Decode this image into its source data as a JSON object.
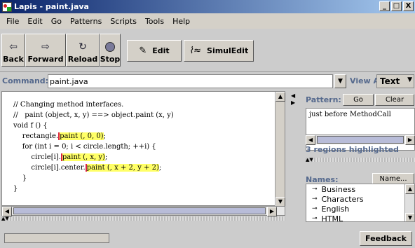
{
  "window": {
    "title": "Lapis - paint.java",
    "controls": [
      "_",
      "□",
      "X"
    ]
  },
  "menu": [
    "File",
    "Edit",
    "Go",
    "Patterns",
    "Scripts",
    "Tools",
    "Help"
  ],
  "toolbar": {
    "back": {
      "label": "Back",
      "icon": "back-arrow-icon"
    },
    "forward": {
      "label": "Forward",
      "icon": "forward-arrow-icon"
    },
    "reload": {
      "label": "Reload",
      "icon": "reload-icon"
    },
    "stop": {
      "label": "Stop",
      "icon": "stop-icon"
    },
    "edit": {
      "label": "Edit",
      "icon": "pencil-icon"
    },
    "simuledit": {
      "label": "SimulEdit",
      "icon": "simuledit-icon"
    }
  },
  "command": {
    "label": "Command:",
    "value": "paint.java",
    "view_as_label": "View As:",
    "view_as_value": "Text"
  },
  "editor": {
    "lines": [
      {
        "parts": [
          {
            "text": "// Changing method interfaces."
          }
        ]
      },
      {
        "parts": [
          {
            "text": "//   paint (object, x, y) ==> object.paint (x, y)"
          }
        ]
      },
      {
        "parts": [
          {
            "text": "void f () {"
          }
        ]
      },
      {
        "parts": [
          {
            "text": "    rectangle."
          },
          {
            "text": "paint (, 0, 0)",
            "hl": true
          },
          {
            "text": ";"
          }
        ]
      },
      {
        "parts": [
          {
            "text": "    for (int i = 0; i < circle.length; ++i) {"
          }
        ]
      },
      {
        "parts": [
          {
            "text": "        circle[i]."
          },
          {
            "text": "paint (, x, y)",
            "hl": true
          },
          {
            "text": ";"
          }
        ]
      },
      {
        "parts": [
          {
            "text": "        circle[i].center."
          },
          {
            "text": "paint (, x + 2, y + 2)",
            "hl": true
          },
          {
            "text": ";"
          }
        ]
      },
      {
        "parts": [
          {
            "text": "    }"
          }
        ]
      },
      {
        "parts": [
          {
            "text": "}"
          }
        ]
      }
    ]
  },
  "pattern_panel": {
    "label": "Pattern:",
    "go_label": "Go",
    "clear_label": "Clear",
    "pattern_text": "just before MethodCall",
    "regions_text": "3 regions highlighted"
  },
  "names_panel": {
    "label": "Names:",
    "name_button": "Name...",
    "items": [
      "Business",
      "Characters",
      "English",
      "HTML"
    ]
  },
  "status": {
    "feedback_label": "Feedback"
  },
  "colors": {
    "label_blue": "#55698d",
    "highlight": "#ffff66",
    "title_dark": "#0a246a"
  }
}
